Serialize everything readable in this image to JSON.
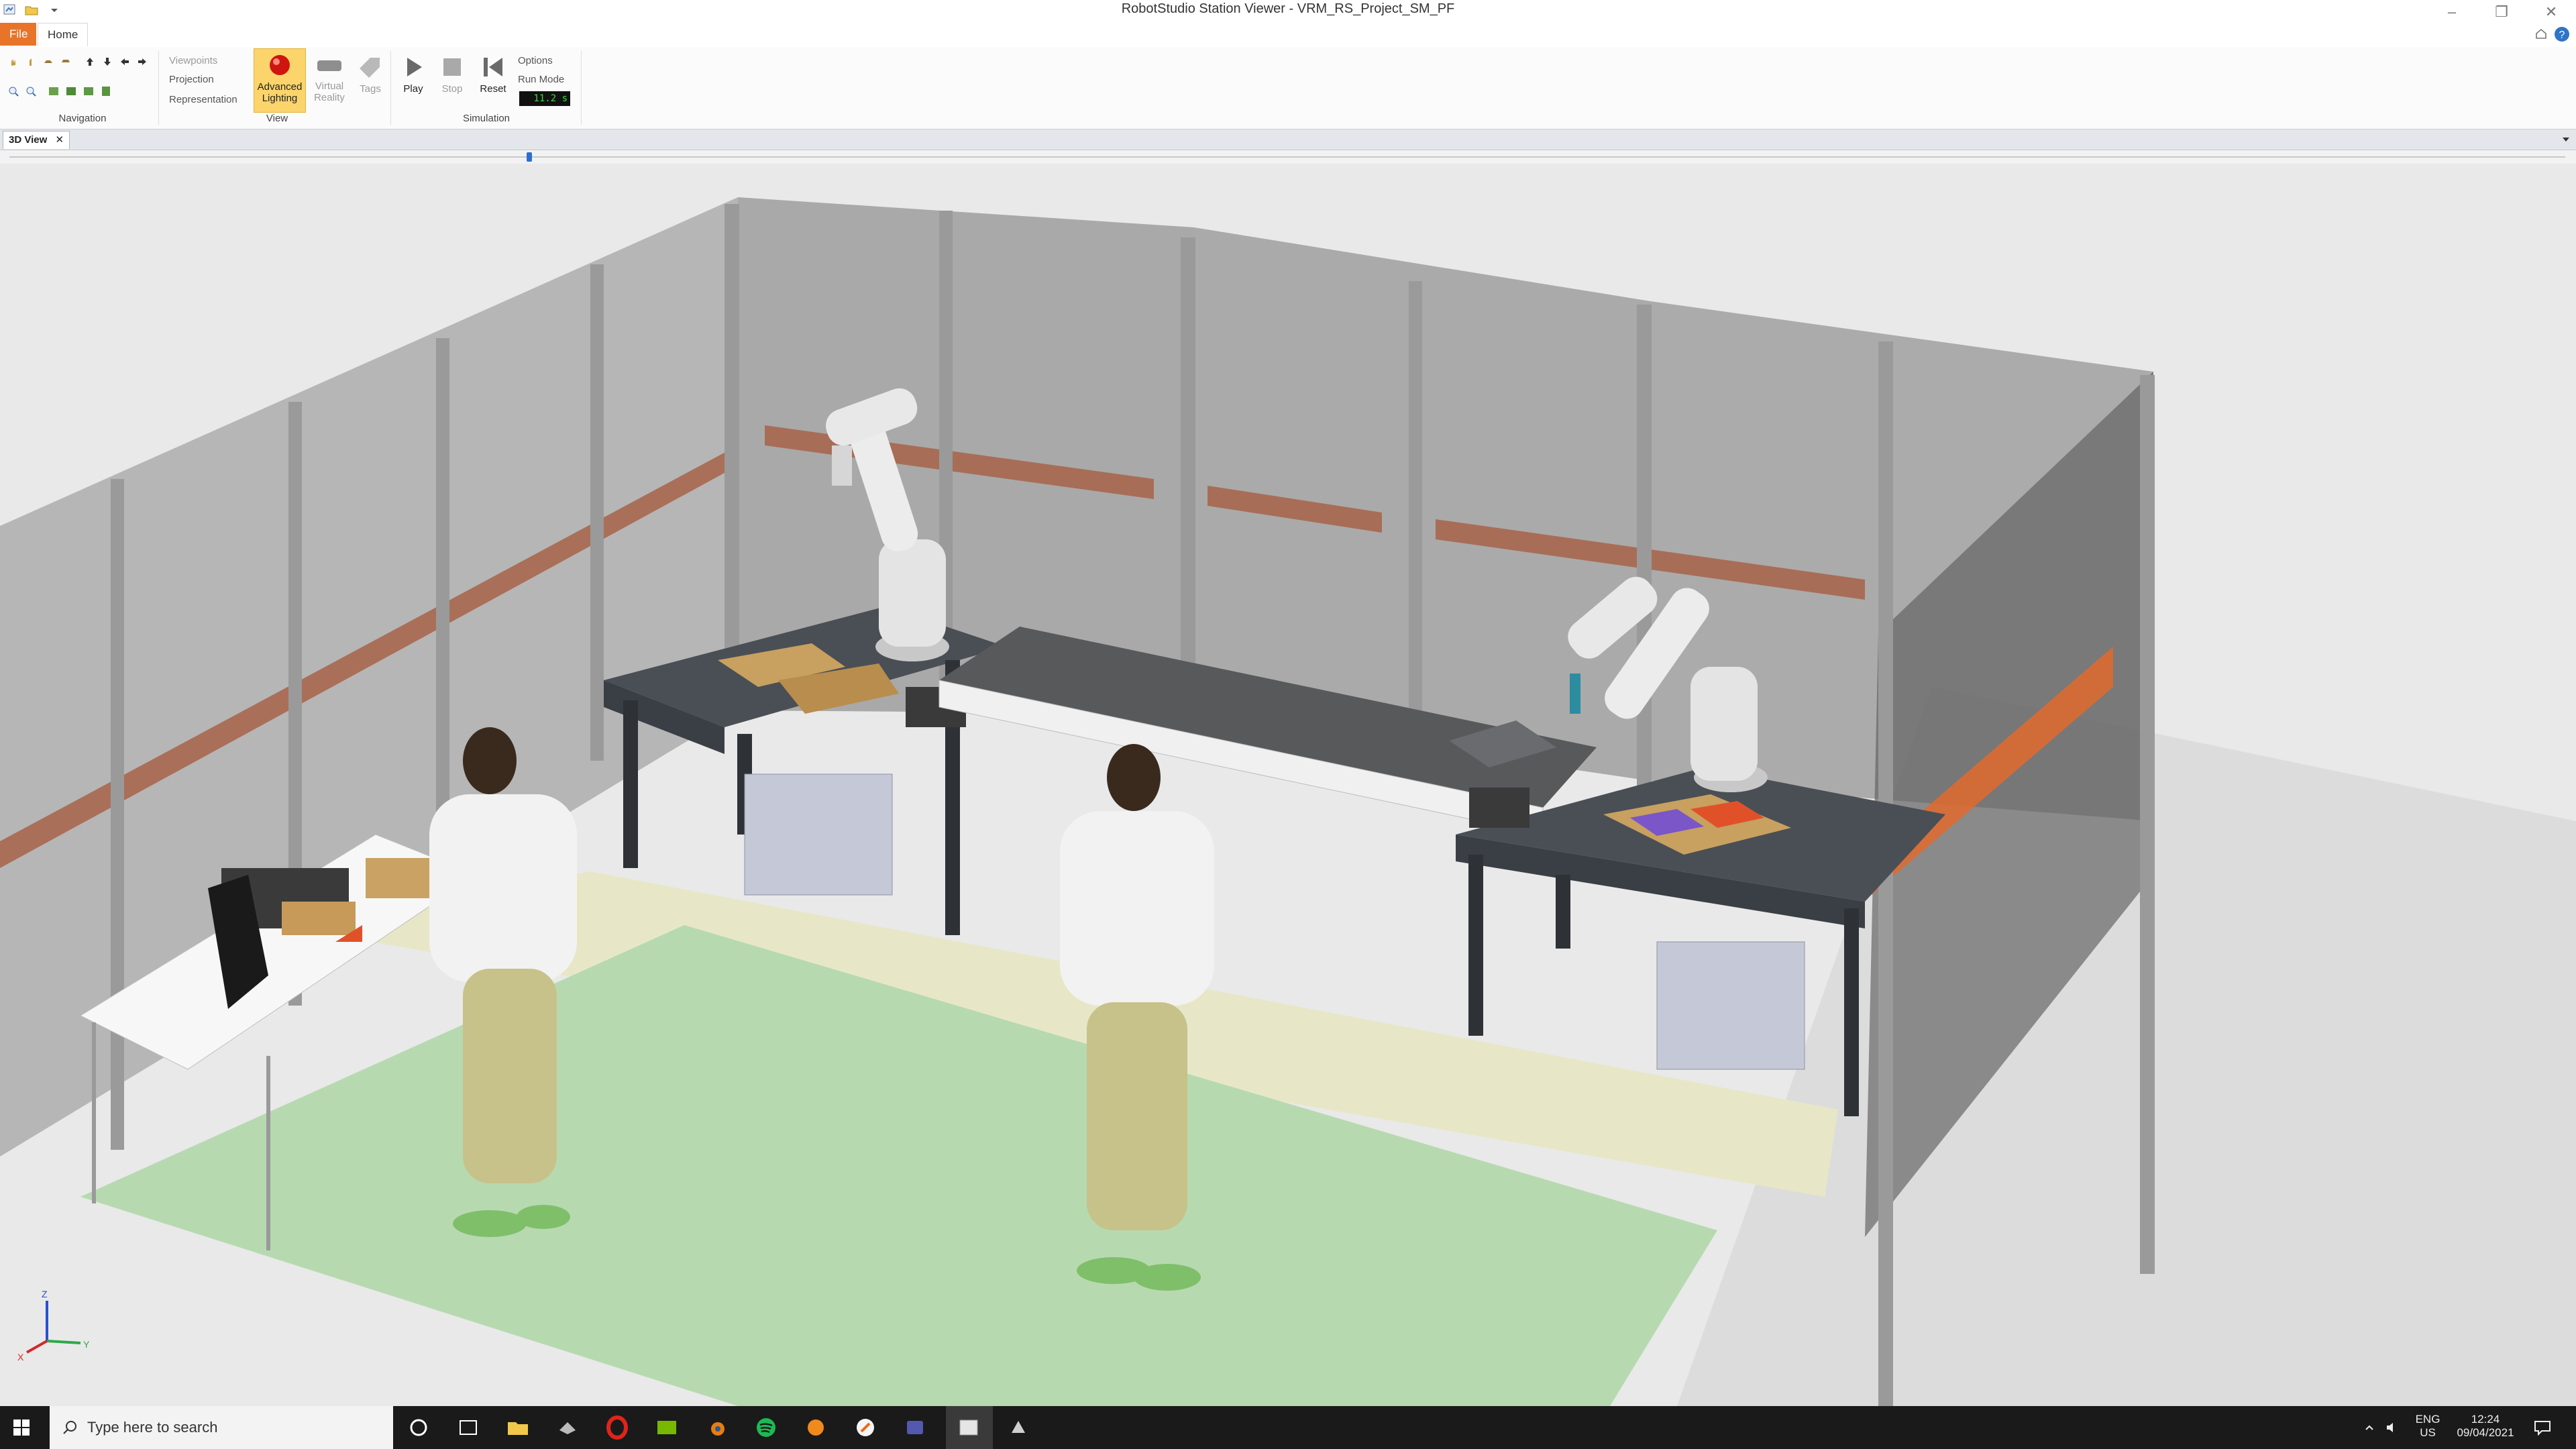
{
  "window": {
    "title": "RobotStudio Station Viewer - VRM_RS_Project_SM_PF",
    "min_icon": "minimize-icon",
    "max_icon": "restore-icon",
    "close_icon": "close-icon"
  },
  "ribbon": {
    "tabs": [
      {
        "label": "File"
      },
      {
        "label": "Home"
      }
    ],
    "groups": {
      "navigation": {
        "label": "Navigation"
      },
      "view": {
        "label": "View",
        "viewpoints": "Viewpoints",
        "projection": "Projection",
        "representation": "Representation",
        "advanced_lighting_line1": "Advanced",
        "advanced_lighting_line2": "Lighting",
        "virtual_reality_line1": "Virtual",
        "virtual_reality_line2": "Reality",
        "tags": "Tags"
      },
      "simulation": {
        "label": "Simulation",
        "play": "Play",
        "stop": "Stop",
        "reset": "Reset",
        "options": "Options",
        "run_mode": "Run Mode",
        "sim_time": "11.2 s"
      }
    }
  },
  "document": {
    "tab_label": "3D View",
    "close_icon": "close-icon"
  },
  "viewport": {
    "axes": {
      "x": "X",
      "y": "Y",
      "z": "Z"
    },
    "accent_colors": {
      "fence_stripe": "#e06a2e",
      "floor_zone": "#b7d9b0",
      "walkway": "#e7e7c8"
    }
  },
  "taskbar": {
    "search_placeholder": "Type here to search",
    "language_line1": "ENG",
    "language_line2": "US",
    "time": "12:24",
    "date": "09/04/2021"
  }
}
